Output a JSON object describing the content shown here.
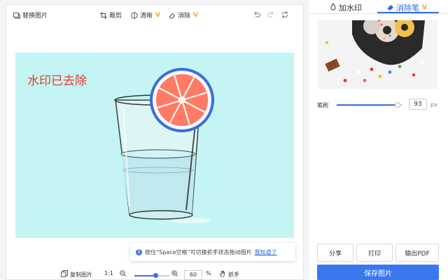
{
  "toolbar": {
    "replace_label": "替换图片",
    "crop_label": "裁剪",
    "clear_label": "清晰",
    "erase_label": "消除",
    "vip_badge": "V"
  },
  "canvas": {
    "watermark_text": "水印已去除"
  },
  "tip": {
    "text": "按住“Space空格”可切换抓手状态拖动图片",
    "link": "我知道了",
    "info_glyph": "i"
  },
  "bottom": {
    "copy_label": "复制图片",
    "ratio_label": "1:1",
    "zoom_value": "60",
    "zoom_unit": "%",
    "hand_label": "抓手",
    "zoom_level": 0.6
  },
  "right": {
    "tabs": [
      {
        "label": "加水印"
      },
      {
        "label": "消除笔",
        "badge": "V"
      }
    ],
    "brush_label": "笔刷",
    "brush_value": "93",
    "brush_unit": "px",
    "brush_level": 0.93,
    "buttons": {
      "share": "分享",
      "print": "打印",
      "pdf": "输出PDF",
      "save": "保存图片"
    }
  },
  "colors": {
    "accent": "#2e6ee0",
    "save_button": "#3a78f0",
    "canvas_bg": "#c4f5f4",
    "watermark": "#e53a2f",
    "vip": "#f5a623"
  }
}
